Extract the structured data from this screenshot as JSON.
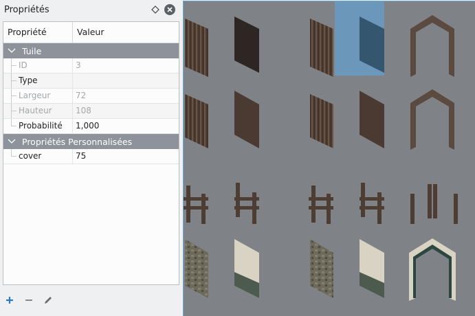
{
  "panel": {
    "title": "Propriétés",
    "float_icon": "diamond-float-icon",
    "close_icon": "close-icon",
    "columns": {
      "property": "Propriété",
      "value": "Valeur"
    },
    "groups": [
      {
        "label": "Tuile",
        "rows": [
          {
            "key": "ID",
            "value": "3",
            "disabled": true
          },
          {
            "key": "Type",
            "value": "",
            "disabled": false
          },
          {
            "key": "Largeur",
            "value": "72",
            "disabled": true
          },
          {
            "key": "Hauteur",
            "value": "108",
            "disabled": true
          },
          {
            "key": "Probabilité",
            "value": "1,000",
            "disabled": false
          }
        ]
      },
      {
        "label": "Propriétés Personnalisées",
        "rows": [
          {
            "key": "cover",
            "value": "75",
            "disabled": false
          }
        ]
      }
    ],
    "toolbar": [
      "add-icon",
      "remove-icon",
      "edit-icon"
    ]
  },
  "tileset": {
    "selected_tile_id": 3,
    "colors": {
      "background": "#7f8286",
      "selection": "#5aaae6",
      "wood": "#4e3d32",
      "stone": "#6d6a5c"
    }
  }
}
